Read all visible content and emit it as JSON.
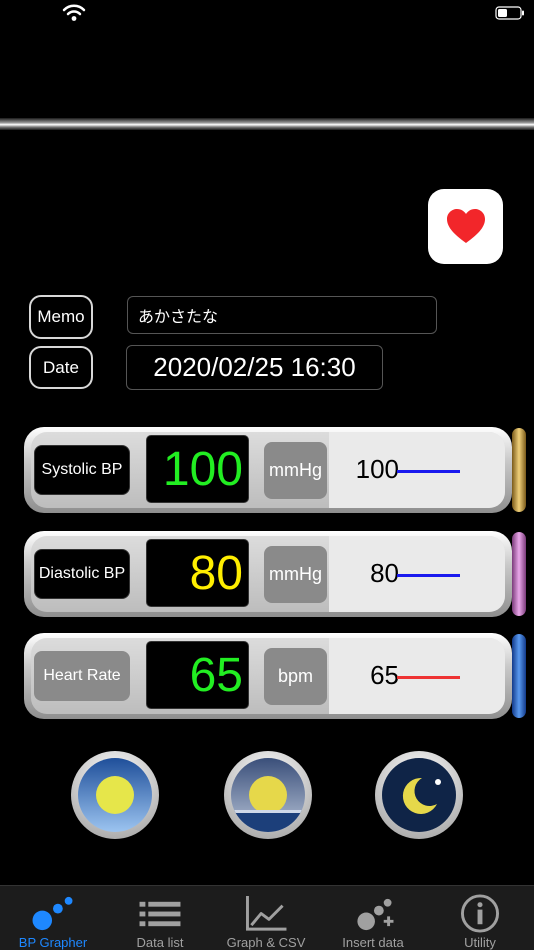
{
  "memo": {
    "label": "Memo",
    "value": "あかさたな"
  },
  "date": {
    "label": "Date",
    "value": "2020/02/25 16:30"
  },
  "rows": [
    {
      "name": "Systolic BP",
      "value": "100",
      "unit": "mmHg",
      "legend_value": "100",
      "value_color": "#22ee22",
      "line_color": "#1a1aee",
      "tab_color": "#c9a24a"
    },
    {
      "name": "Diastolic BP",
      "value": "80",
      "unit": "mmHg",
      "legend_value": "80",
      "value_color": "#ffee00",
      "line_color": "#1a1aee",
      "tab_color": "#c47ac4"
    },
    {
      "name": "Heart Rate",
      "value": "65",
      "unit": "bpm",
      "legend_value": "65",
      "value_color": "#22ee22",
      "line_color": "#ee3333",
      "tab_color": "#2a6ad8"
    }
  ],
  "scene_buttons": [
    {
      "icon": "sun-icon"
    },
    {
      "icon": "sunset-icon"
    },
    {
      "icon": "moon-icon"
    }
  ],
  "tabs": [
    {
      "label": "BP Grapher",
      "icon": "bp-grapher-icon",
      "active": true
    },
    {
      "label": "Data list",
      "icon": "list-icon",
      "active": false
    },
    {
      "label": "Graph & CSV",
      "icon": "graph-icon",
      "active": false
    },
    {
      "label": "Insert data",
      "icon": "insert-data-icon",
      "active": false
    },
    {
      "label": "Utility",
      "icon": "info-icon",
      "active": false
    }
  ],
  "colors": {
    "active_tab": "#1e88ff",
    "inactive_tab": "#a0a0a0"
  }
}
